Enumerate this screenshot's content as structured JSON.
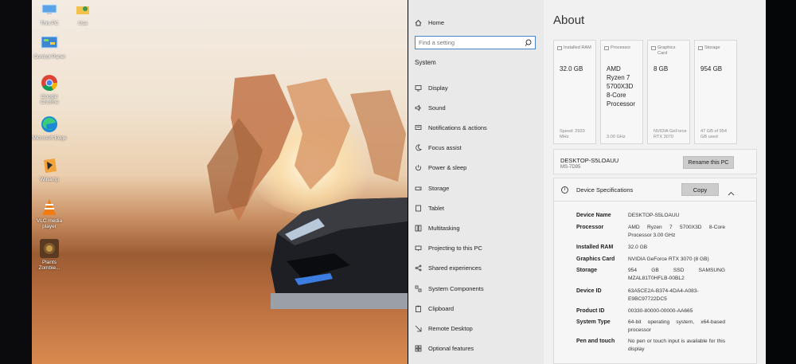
{
  "desktop": {
    "icons": [
      {
        "label": "This PC",
        "icon": "computer-icon"
      },
      {
        "label": "Usa",
        "icon": "user-folder-icon"
      },
      {
        "label": "Control Panel",
        "icon": "control-panel-icon"
      },
      {
        "label": "Google Chrome",
        "icon": "chrome-icon"
      },
      {
        "label": "Microsoft Edge",
        "icon": "edge-icon"
      },
      {
        "label": "Winamp",
        "icon": "winamp-icon"
      },
      {
        "label": "VLC media player",
        "icon": "vlc-icon"
      },
      {
        "label": "Plants Zombie...",
        "icon": "game-icon"
      }
    ]
  },
  "settings": {
    "nav": {
      "home": "Home",
      "search_placeholder": "Find a setting",
      "section": "System",
      "items": [
        {
          "label": "Display",
          "icon": "monitor-icon"
        },
        {
          "label": "Sound",
          "icon": "speaker-icon"
        },
        {
          "label": "Notifications & actions",
          "icon": "notification-icon"
        },
        {
          "label": "Focus assist",
          "icon": "moon-icon"
        },
        {
          "label": "Power & sleep",
          "icon": "power-icon"
        },
        {
          "label": "Storage",
          "icon": "drive-icon"
        },
        {
          "label": "Tablet",
          "icon": "tablet-icon"
        },
        {
          "label": "Multitasking",
          "icon": "multitasking-icon"
        },
        {
          "label": "Projecting to this PC",
          "icon": "projector-icon"
        },
        {
          "label": "Shared experiences",
          "icon": "share-icon"
        },
        {
          "label": "System Components",
          "icon": "components-icon"
        },
        {
          "label": "Clipboard",
          "icon": "clipboard-icon"
        },
        {
          "label": "Remote Desktop",
          "icon": "remote-icon"
        },
        {
          "label": "Optional features",
          "icon": "features-icon"
        }
      ]
    },
    "about": {
      "title": "About",
      "cards": [
        {
          "label": "Installed RAM",
          "value": "32.0 GB",
          "sub": "Speed: 2933 MHz"
        },
        {
          "label": "Processor",
          "value": "AMD Ryzen 7 5700X3D 8-Core Processor",
          "sub": "3.00 GHz"
        },
        {
          "label": "Graphics Card",
          "value": "8 GB",
          "sub": "NVIDIA GeForce RTX 3070"
        },
        {
          "label": "Storage",
          "value": "954 GB",
          "sub": "47 GB of 954 GB used"
        }
      ],
      "pc_name": "DESKTOP-S5LOAUU",
      "pc_model": "MS-7D95",
      "rename_label": "Rename this PC",
      "spec_heading": "Device Specifications",
      "copy_label": "Copy",
      "specs": [
        {
          "key": "Device Name",
          "value": "DESKTOP-S5LOAUU"
        },
        {
          "key": "Processor",
          "value": "AMD Ryzen 7 5700X3D 8-Core Processor 3.00 GHz"
        },
        {
          "key": "Installed RAM",
          "value": "32.0 GB"
        },
        {
          "key": "Graphics Card",
          "value": "NVIDIA GeForce RTX 3070 (8 GB)"
        },
        {
          "key": "Storage",
          "value": "954 GB SSD SAMSUNG MZAL81T0HFLB-00BL2"
        },
        {
          "key": "Device ID",
          "value": "63A5CE2A-B374-4DA4-A083-E9BC97722DC5"
        },
        {
          "key": "Product ID",
          "value": "00330-80000-00000-AA665"
        },
        {
          "key": "System Type",
          "value": "64-bit operating system, x64-based processor"
        },
        {
          "key": "Pen and touch",
          "value": "No pen or touch input is available for this display"
        }
      ]
    }
  }
}
